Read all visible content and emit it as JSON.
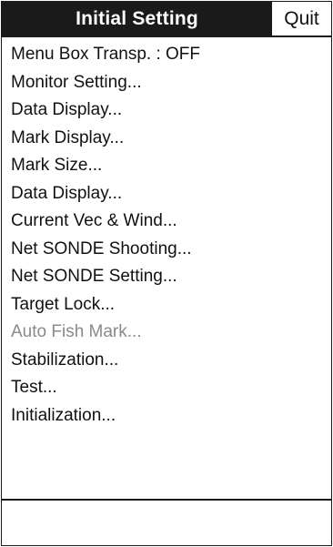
{
  "window": {
    "title": "Initial Setting",
    "quit_label": "Quit"
  },
  "menu": {
    "items": [
      {
        "label": "Menu Box Transp.  : OFF",
        "enabled": true
      },
      {
        "label": "Monitor Setting...",
        "enabled": true
      },
      {
        "label": "Data Display...",
        "enabled": true
      },
      {
        "label": "Mark Display...",
        "enabled": true
      },
      {
        "label": "Mark Size...",
        "enabled": true
      },
      {
        "label": "Data Display...",
        "enabled": true
      },
      {
        "label": "Current Vec & Wind...",
        "enabled": true
      },
      {
        "label": "Net SONDE Shooting...",
        "enabled": true
      },
      {
        "label": "Net SONDE Setting...",
        "enabled": true
      },
      {
        "label": "Target Lock...",
        "enabled": true
      },
      {
        "label": "Auto Fish Mark...",
        "enabled": false
      },
      {
        "label": "Stabilization...",
        "enabled": true
      },
      {
        "label": "Test...",
        "enabled": true
      },
      {
        "label": "Initialization...",
        "enabled": true
      }
    ]
  },
  "status": {
    "text": ""
  },
  "colors": {
    "title_bg": "#1a1a1a",
    "title_fg": "#ffffff",
    "text": "#111111",
    "disabled_text": "#8a8a8a"
  }
}
